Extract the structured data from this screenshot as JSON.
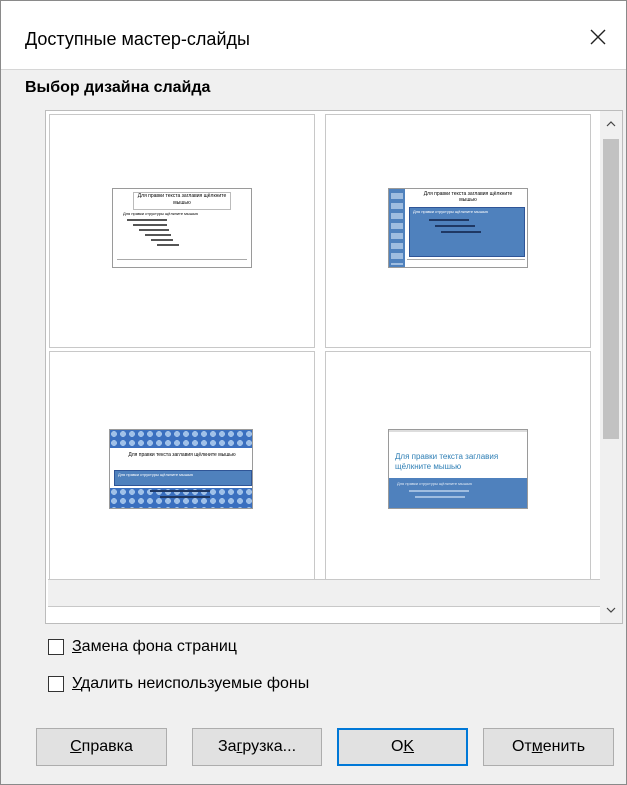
{
  "window": {
    "title": "Доступные мастер-слайды",
    "close_icon": "close-icon"
  },
  "section": {
    "title": "Выбор дизайна слайда"
  },
  "thumbnails": [
    {
      "title": "Для правки текста заглавия щёлкните мышью",
      "bullet": "Для правки структуры щёлкните мышью"
    },
    {
      "title": "Для правки текста заглавия щёлкните мышью",
      "bullet": "Для правки структуры щёлкните мышью"
    },
    {
      "title": "Для правки текста заглавия щёлкните мышью",
      "bullet": "Для правки структуры щёлкните мышью"
    },
    {
      "title": "Для правки текста заглавия щёлкните мышью",
      "bullet": "Для правки структуры щёлкните мышью"
    }
  ],
  "options": {
    "replace_bg": {
      "label_u": "З",
      "label_rest": "амена фона страниц",
      "checked": false
    },
    "delete_unused": {
      "label_u": "У",
      "label_rest": "далить неиспользуемые фоны",
      "checked": false
    }
  },
  "buttons": {
    "help": {
      "u": "С",
      "rest": "правка"
    },
    "load": {
      "pre": "За",
      "u": "г",
      "rest": "рузка..."
    },
    "ok": {
      "pre": "О",
      "u": "K",
      "rest": ""
    },
    "cancel": {
      "pre": "От",
      "u": "м",
      "rest": "енить"
    }
  },
  "colors": {
    "accent": "#0078d7",
    "thumb_blue": "#4f81bd"
  }
}
